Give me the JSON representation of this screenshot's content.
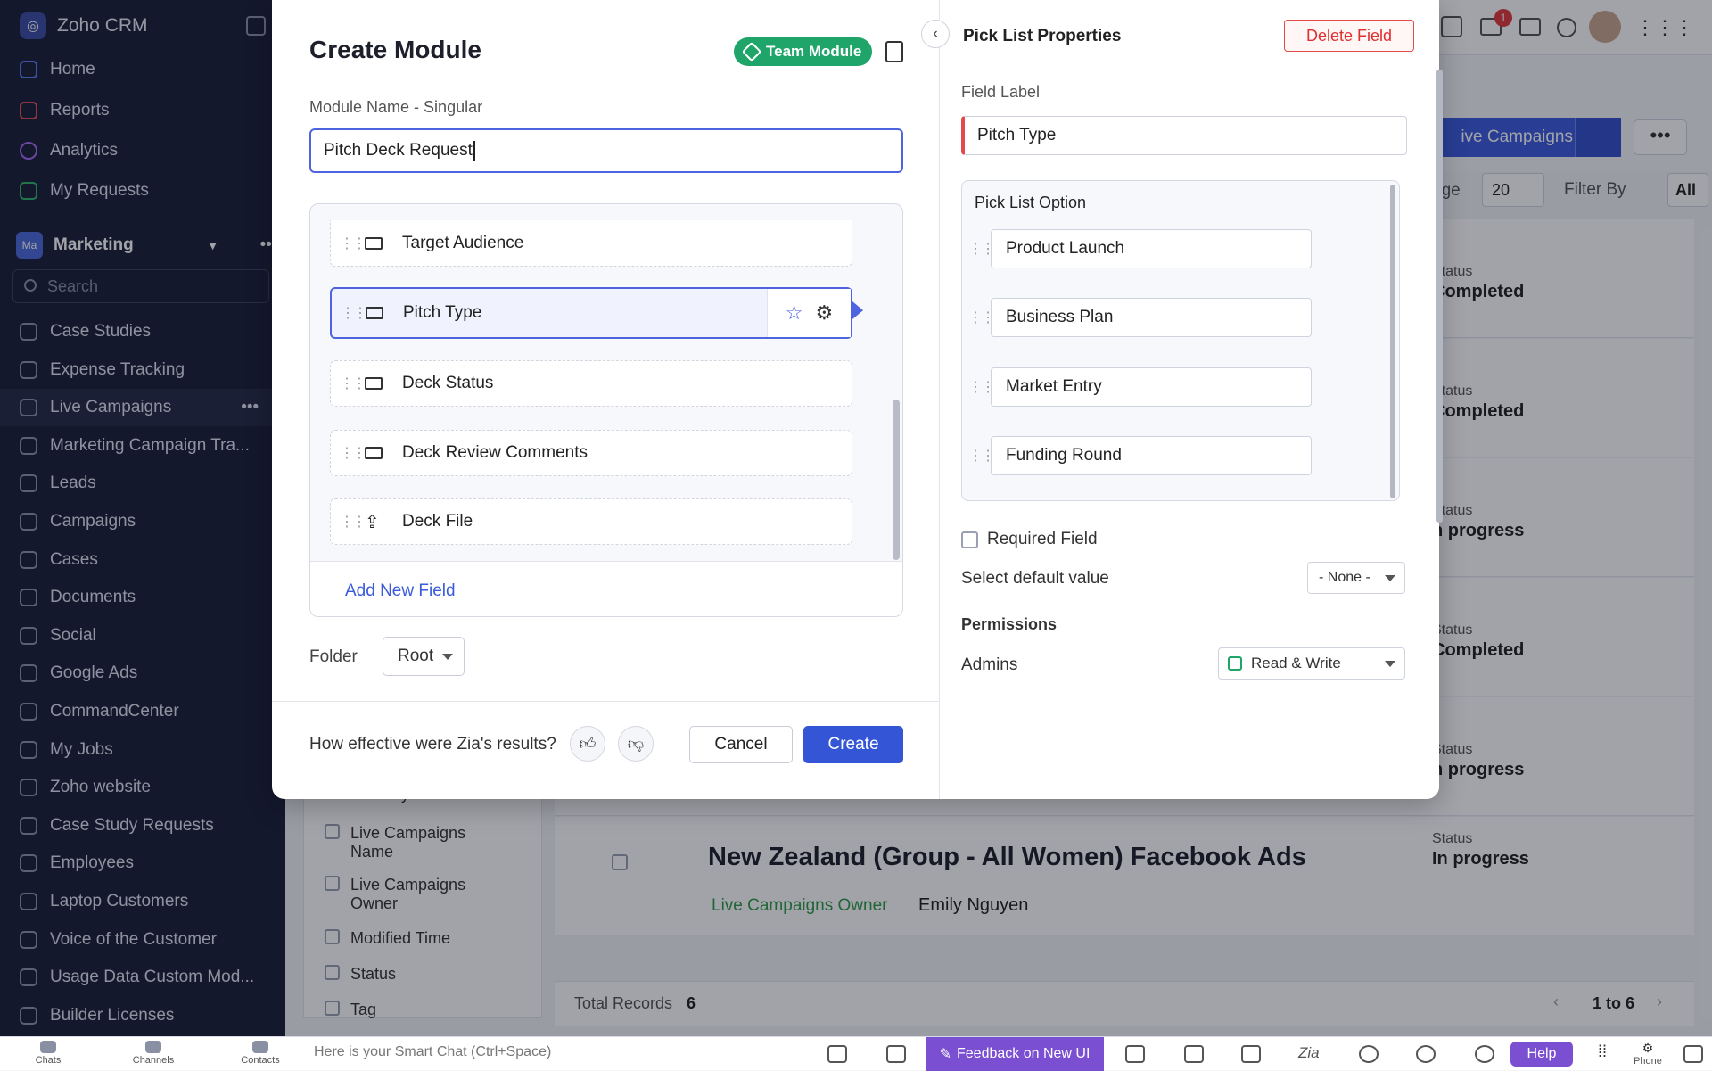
{
  "sidebar": {
    "app_name": "Zoho CRM",
    "top_items": [
      {
        "label": "Home",
        "icon": "home-icon"
      },
      {
        "label": "Reports",
        "icon": "reports-icon"
      },
      {
        "label": "Analytics",
        "icon": "analytics-icon"
      },
      {
        "label": "My Requests",
        "icon": "requests-icon"
      }
    ],
    "team": {
      "badge": "Ma",
      "name": "Marketing"
    },
    "search_placeholder": "Search",
    "modules": [
      "Case Studies",
      "Expense Tracking",
      "Live Campaigns",
      "Marketing Campaign Tra...",
      "Leads",
      "Campaigns",
      "Cases",
      "Documents",
      "Social",
      "Google Ads",
      "CommandCenter",
      "My Jobs",
      "Zoho website",
      "Case Study Requests",
      "Employees",
      "Laptop Customers",
      "Voice of the Customer",
      "Usage Data Custom Mod...",
      "Builder Licenses"
    ],
    "active_module": "Live Campaigns"
  },
  "background": {
    "notification_count": "1",
    "primary_button": "ive Campaigns",
    "more_label": "•••",
    "per_page_label": "age",
    "per_page_value": "20",
    "filter_by_label": "Filter By",
    "filter_value": "All",
    "status_label": "Status",
    "rows": [
      {
        "status": "Completed"
      },
      {
        "status": "Completed"
      },
      {
        "status": "n progress"
      },
      {
        "status": "Completed"
      },
      {
        "status": "n progress"
      },
      {
        "title": "New Zealand (Group - All Women) Facebook Ads",
        "owner_label": "Live Campaigns Owner",
        "owner": "Emily Nguyen",
        "status": "In progress"
      }
    ],
    "filter_fields": [
      "Last Activity Time",
      "Live Campaigns Name",
      "Live Campaigns Owner",
      "Modified Time",
      "Status",
      "Tag"
    ],
    "total_records_label": "Total Records",
    "total_records": "6",
    "pagination": "1 to 6"
  },
  "modal": {
    "title": "Create Module",
    "team_badge": "Team Module",
    "name_label": "Module Name - Singular",
    "name_value": "Pitch Deck Request",
    "fields": [
      {
        "label": "Target Audience",
        "icon": "picklist-icon"
      },
      {
        "label": "Pitch Type",
        "icon": "picklist-icon",
        "selected": true
      },
      {
        "label": "Deck Status",
        "icon": "picklist-icon"
      },
      {
        "label": "Deck Review Comments",
        "icon": "textarea-icon"
      },
      {
        "label": "Deck File",
        "icon": "upload-icon"
      }
    ],
    "add_field": "Add New Field",
    "folder_label": "Folder",
    "folder_value": "Root",
    "zia_question": "How effective were Zia's results?",
    "cancel": "Cancel",
    "create": "Create"
  },
  "properties": {
    "title": "Pick List Properties",
    "delete": "Delete Field",
    "field_label_label": "Field Label",
    "field_label_value": "Pitch Type",
    "options_title": "Pick List Option",
    "options": [
      "Product Launch",
      "Business Plan",
      "Market Entry",
      "Funding Round"
    ],
    "required_label": "Required Field",
    "required_checked": false,
    "default_label": "Select default value",
    "default_value": "- None -",
    "permissions_title": "Permissions",
    "admins_label": "Admins",
    "admins_value": "Read & Write"
  },
  "bottombar": {
    "items": [
      "Chats",
      "Channels",
      "Contacts"
    ],
    "smart_chat_placeholder": "Here is your Smart Chat (Ctrl+Space)",
    "feedback": "Feedback on New UI",
    "help": "Help",
    "phone": "Phone"
  },
  "colors": {
    "accent": "#3355d6",
    "team": "#1fa56a",
    "danger": "#e02f2f",
    "sidebar": "#1b2038"
  }
}
